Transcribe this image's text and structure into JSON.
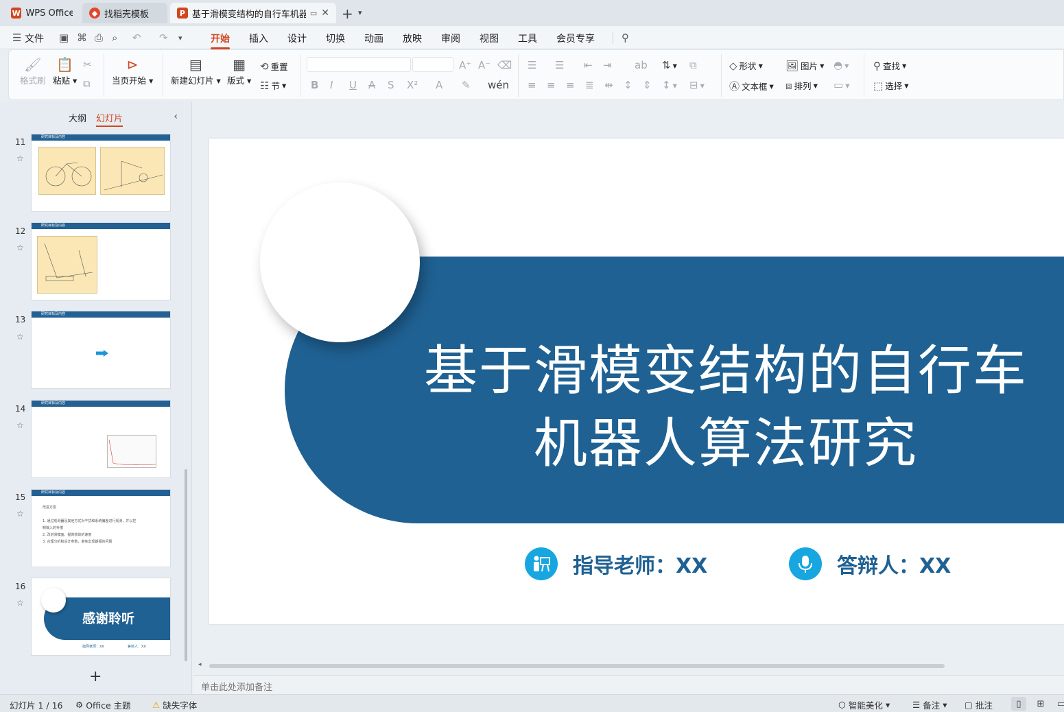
{
  "tabs": {
    "wps": "WPS Office",
    "template": "找稻壳模板",
    "doc": "基于滑模变结构的自行车机器人",
    "new_tab_icon": "+"
  },
  "menu": {
    "file": "文件",
    "items": [
      "开始",
      "插入",
      "设计",
      "切换",
      "动画",
      "放映",
      "审阅",
      "视图",
      "工具",
      "会员专享"
    ],
    "active": "开始"
  },
  "ribbon": {
    "format_painter": "格式刷",
    "paste": "粘贴",
    "play_from_current": "当页开始",
    "new_slide": "新建幻灯片",
    "layout": "版式",
    "reset": "重置",
    "section": "节",
    "shape": "形状",
    "picture": "图片",
    "textbox": "文本框",
    "arrange": "排列",
    "find": "查找",
    "select": "选择"
  },
  "leftpane": {
    "tab_outline": "大纲",
    "tab_slides": "幻灯片",
    "slide_numbers": [
      "11",
      "12",
      "13",
      "14",
      "15",
      "16"
    ],
    "thumb_header": "研究目标及内容",
    "thumb15_lines": [
      "改进方案",
      "1. 通过观测器及其他方式对干扰和系统偏差进行观测，并以控",
      "制输入的补偿",
      "2. 改进滑模面，提高收敛的速度",
      "3. 合理分析和设计参数，避免出现颤振的问题"
    ],
    "thumb16_title": "感谢聆听",
    "thumb16_advisor": "指导老师：XX",
    "thumb16_defender": "答辩人：XX"
  },
  "slide": {
    "title_line1": "基于滑模变结构的自行车",
    "title_line2": "机器人算法研究",
    "advisor": "指导老师：XX",
    "defender": "答辩人：XX"
  },
  "notes_placeholder": "单击此处添加备注",
  "status": {
    "slide_count": "幻灯片 1 / 16",
    "theme": "Office 主题",
    "missing_font": "缺失字体",
    "smart_beautify": "智能美化",
    "notes": "备注",
    "comments": "批注"
  },
  "colors": {
    "accent": "#d2461f",
    "slide_blue": "#1f6193",
    "icon_blue": "#17a6e0"
  }
}
